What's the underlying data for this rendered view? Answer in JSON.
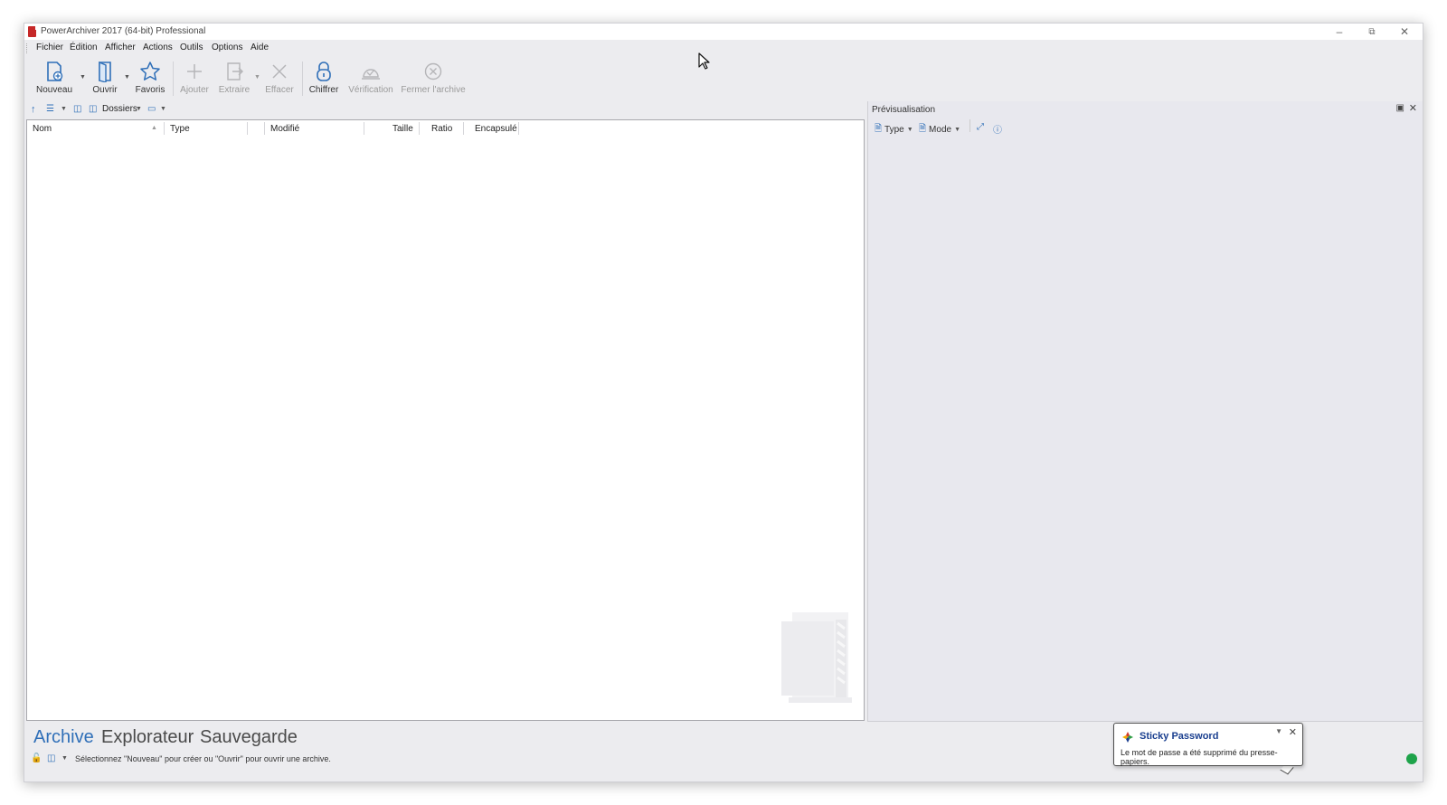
{
  "window": {
    "title": "PowerArchiver 2017 (64-bit) Professional"
  },
  "menu": [
    "Fichier",
    "Édition",
    "Afficher",
    "Actions",
    "Outils",
    "Options",
    "Aide"
  ],
  "toolbar": {
    "nouveau": "Nouveau",
    "ouvrir": "Ouvrir",
    "favoris": "Favoris",
    "ajouter": "Ajouter",
    "extraire": "Extraire",
    "effacer": "Effacer",
    "chiffrer": "Chiffrer",
    "verification": "Vérification",
    "fermer": "Fermer l'archive"
  },
  "left_toolbar": {
    "dossiers": "Dossiers"
  },
  "columns": [
    "Nom",
    "Type",
    "Modifié",
    "Taille",
    "Ratio",
    "Encapsulé"
  ],
  "preview": {
    "title": "Prévisualisation",
    "type_label": "Type",
    "mode_label": "Mode"
  },
  "bottom_tabs": [
    "Archive",
    "Explorateur",
    "Sauvegarde"
  ],
  "status": {
    "text": "Sélectionnez \"Nouveau\" pour créer ou \"Ouvrir\" pour ouvrir une archive."
  },
  "toast": {
    "title": "Sticky Password",
    "message": "Le mot de passe a été supprimé du presse-papiers."
  },
  "colors": {
    "accent": "#2f6fb8",
    "disabled": "#9a9a9a",
    "status_ok": "#1ea34a",
    "toast_title": "#1a3f8f"
  }
}
